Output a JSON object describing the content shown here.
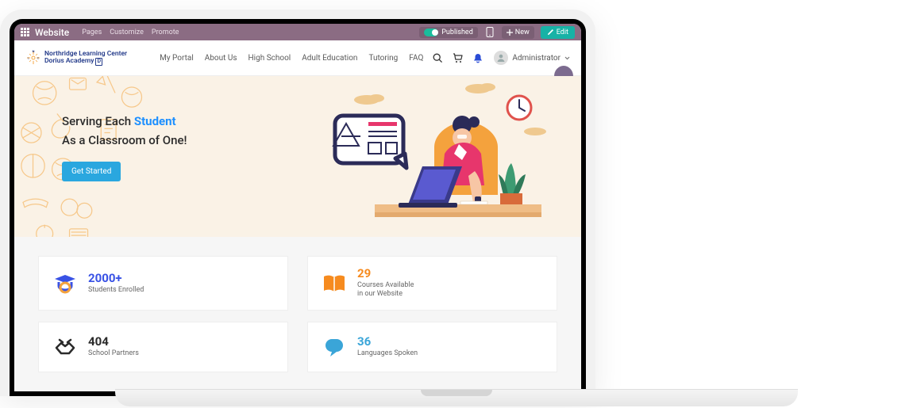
{
  "admin_bar": {
    "brand": "Website",
    "links": [
      "Pages",
      "Customize",
      "Promote"
    ],
    "published_label": "Published",
    "new_label": "New",
    "edit_label": "Edit"
  },
  "header": {
    "logo_line1": "Northridge Learning Center",
    "logo_line2": "Dorius Academy",
    "nav": [
      "My Portal",
      "About Us",
      "High School",
      "Adult Education",
      "Tutoring",
      "FAQ"
    ],
    "user": "Administrator"
  },
  "hero": {
    "line1_a": "Serving Each ",
    "line1_b": "Student",
    "line2": "As a Classroom of One!",
    "cta": "Get Started"
  },
  "stats": [
    {
      "value": "2000+",
      "label": "Students Enrolled"
    },
    {
      "value": "29",
      "label": "Courses Available\nin our Website"
    },
    {
      "value": "404",
      "label": "School Partners"
    },
    {
      "value": "36",
      "label": "Languages Spoken"
    }
  ]
}
